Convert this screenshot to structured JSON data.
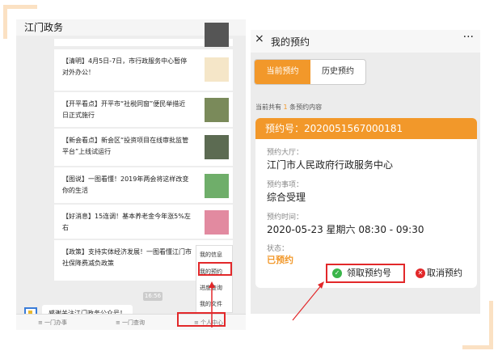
{
  "left_phone": {
    "title": "江门政务",
    "feed": [
      {
        "text": "【清明】4月5日-7日，市行政服务中心暂停对外办公！"
      },
      {
        "text": "【开平看点】开平市“社税同窗”便民举措近日正式施行"
      },
      {
        "text": "【新会看点】新会区“投资项目在线审批监管平台”上线试运行"
      },
      {
        "text": "【图说】一图看懂！2019年两会将这样改变你的生活"
      },
      {
        "text": "【好消息】15连调！基本养老金今年涨5%左右"
      },
      {
        "text": "【政策】支持实体经济发展！一图看懂江门市社保降费减负政策"
      }
    ],
    "time_badge": "16:56",
    "bot_message": "感谢关注江门政务公众号！",
    "tabbar": [
      "≡ 一门办事",
      "≡ 一门查询",
      "≡ 个人中心"
    ],
    "popup_menu": [
      "我的信息",
      "我的预约",
      "进度查询",
      "我的文件"
    ]
  },
  "right_phone": {
    "close_icon": "×",
    "title": "我的预约",
    "more_icon": "···",
    "tabs": [
      "当前预约",
      "历史预约"
    ],
    "count_prefix": "当前共有 ",
    "count": "1",
    "count_suffix": " 条预约内容",
    "card": {
      "header": "预约号：2020051567000181",
      "hall_label": "预约大厅：",
      "hall_value": "江门市人民政府行政服务中心",
      "item_label": "预约事项：",
      "item_value": "综合受理",
      "time_label": "预约时间：",
      "time_value": "2020-05-23 星期六 08:30 - 09:30",
      "status_label": "状态：",
      "status_value": "已预约",
      "get_button": "领取预约号",
      "cancel_button": "取消预约"
    }
  },
  "colors": {
    "accent": "#f2982a",
    "highlight": "#e2282a",
    "success": "#3ab54a"
  }
}
